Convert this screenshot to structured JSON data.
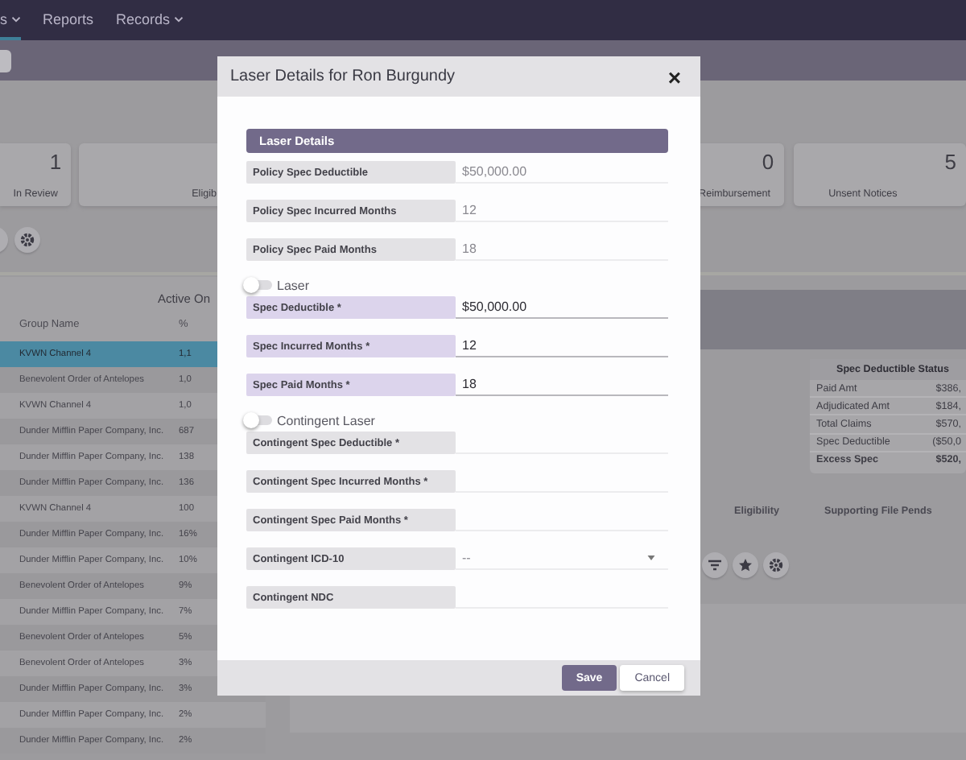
{
  "nav": {
    "items": [
      {
        "label": "s",
        "dropdown": true,
        "selected": true
      },
      {
        "label": "Reports",
        "dropdown": false,
        "selected": false
      },
      {
        "label": "Records",
        "dropdown": true,
        "selected": false
      }
    ]
  },
  "stats": [
    {
      "value": "1",
      "label": "In Review",
      "kind": "left"
    },
    {
      "label": "Eligib",
      "kind": "wide"
    },
    {
      "value": "0",
      "label": "Reimbursement",
      "kind": "normal"
    },
    {
      "value": "5",
      "label": "Unsent Notices",
      "kind": "right"
    }
  ],
  "groups_table": {
    "title": "Active On",
    "columns": [
      "Group Name",
      "%"
    ],
    "rows": [
      {
        "group": "KVWN Channel 4",
        "pct": "1,1",
        "selected": true
      },
      {
        "group": "Benevolent Order of Antelopes",
        "pct": "1,0",
        "selected": false
      },
      {
        "group": "KVWN Channel 4",
        "pct": "1,0",
        "selected": false
      },
      {
        "group": "Dunder Mifflin Paper Company, Inc.",
        "pct": "687",
        "selected": false
      },
      {
        "group": "Dunder Mifflin Paper Company, Inc.",
        "pct": "138",
        "selected": false
      },
      {
        "group": "Dunder Mifflin Paper Company, Inc.",
        "pct": "136",
        "selected": false
      },
      {
        "group": "KVWN Channel 4",
        "pct": "100",
        "selected": false
      },
      {
        "group": "Dunder Mifflin Paper Company, Inc.",
        "pct": "16%",
        "selected": false
      },
      {
        "group": "Dunder Mifflin Paper Company, Inc.",
        "pct": "10%",
        "selected": false
      },
      {
        "group": "Benevolent Order of Antelopes",
        "pct": "9%",
        "selected": false
      },
      {
        "group": "Dunder Mifflin Paper Company, Inc.",
        "pct": "7%",
        "selected": false
      },
      {
        "group": "Benevolent Order of Antelopes",
        "pct": "5%",
        "selected": false
      },
      {
        "group": "Benevolent Order of Antelopes",
        "pct": "3%",
        "selected": false
      },
      {
        "group": "Dunder Mifflin Paper Company, Inc.",
        "pct": "3%",
        "selected": false
      },
      {
        "group": "Dunder Mifflin Paper Company, Inc.",
        "pct": "2%",
        "selected": false
      },
      {
        "group": "Dunder Mifflin Paper Company, Inc.",
        "pct": "2%",
        "selected": false
      }
    ]
  },
  "status": {
    "title": "Spec Deductible Status",
    "rows": [
      {
        "label": "Paid Amt",
        "value": "$386,",
        "kind": "normal"
      },
      {
        "label": "Adjudicated Amt",
        "value": "$184,",
        "kind": "normal"
      },
      {
        "label": "Total Claims",
        "value": "$570,",
        "kind": "normal"
      },
      {
        "label": "Spec Deductible",
        "value": "($50,0",
        "kind": "normal"
      },
      {
        "label": "Excess Spec",
        "value": "$520,",
        "kind": "total"
      }
    ]
  },
  "tabs": [
    {
      "label": "Eligibility",
      "selected": false
    },
    {
      "label": "Supporting File Pends",
      "selected": false
    }
  ],
  "modal": {
    "title": "Laser Details for Ron Burgundy",
    "close": "×",
    "section": "Laser Details",
    "groups": [
      {
        "fields": [
          {
            "kind": "static",
            "label": "Policy Spec Deductible",
            "value": "$50,000.00"
          },
          {
            "kind": "static",
            "label": "Policy Spec Incurred Months",
            "value": "12"
          },
          {
            "kind": "static",
            "label": "Policy Spec Paid Months",
            "value": "18"
          }
        ]
      },
      {
        "toggle": {
          "label": "Laser",
          "on": false
        },
        "fields": [
          {
            "kind": "laser",
            "label": "Spec Deductible *",
            "value": "$50,000.00"
          },
          {
            "kind": "laser",
            "label": "Spec Incurred Months *",
            "value": "12"
          },
          {
            "kind": "laser",
            "label": "Spec Paid Months *",
            "value": "18"
          }
        ]
      },
      {
        "toggle": {
          "label": "Contingent Laser",
          "on": false
        },
        "fields": [
          {
            "kind": "blank",
            "label": "Contingent Spec Deductible *"
          },
          {
            "kind": "blank",
            "label": "Contingent Spec Incurred Months *"
          },
          {
            "kind": "blank",
            "label": "Contingent Spec Paid Months *"
          },
          {
            "kind": "select",
            "label": "Contingent ICD-10",
            "value": "--"
          },
          {
            "kind": "blank",
            "label": "Contingent NDC"
          }
        ]
      }
    ],
    "buttons": [
      {
        "label": "Save",
        "kind": "primary"
      },
      {
        "label": "Cancel",
        "kind": "secondary"
      }
    ]
  }
}
